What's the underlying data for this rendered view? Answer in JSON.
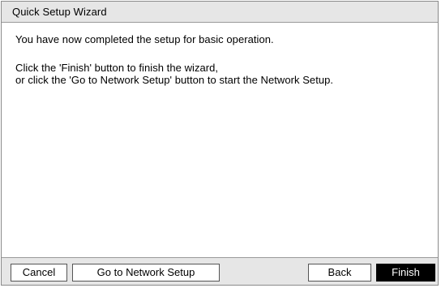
{
  "dialog": {
    "title": "Quick Setup Wizard",
    "message_line1": "You have now completed the setup for basic operation.",
    "message_line2": "Click the 'Finish' button to finish the wizard,",
    "message_line3": "or click the 'Go to Network Setup' button to start the Network Setup."
  },
  "buttons": {
    "cancel": "Cancel",
    "network_setup": "Go to Network Setup",
    "back": "Back",
    "finish": "Finish"
  },
  "colors": {
    "title_bar_bg": "#e6e6e6",
    "footer_bg": "#e6e6e6",
    "primary_button_bg": "#000000",
    "primary_button_text": "#ffffff",
    "border": "#8a8a8a"
  }
}
